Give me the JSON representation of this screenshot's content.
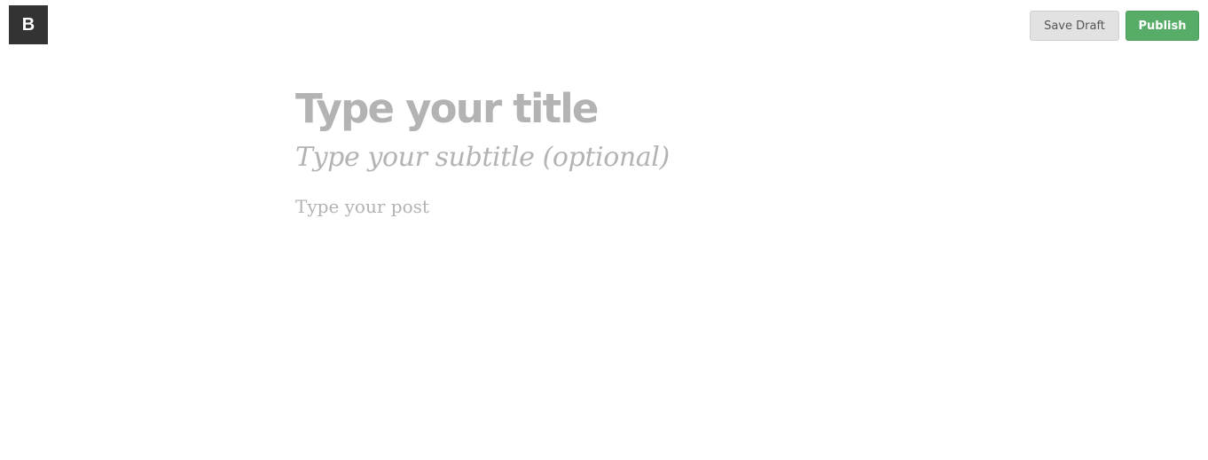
{
  "header": {
    "logo_text": "B",
    "save_draft_label": "Save Draft",
    "publish_label": "Publish"
  },
  "editor": {
    "title_placeholder": "Type your title",
    "subtitle_placeholder": "Type your subtitle (optional)",
    "body_placeholder": "Type your post"
  },
  "colors": {
    "logo_bg": "#333333",
    "publish_bg": "#57ad68",
    "draft_bg": "#e2e2e2",
    "placeholder_text": "#b3b3b3"
  }
}
